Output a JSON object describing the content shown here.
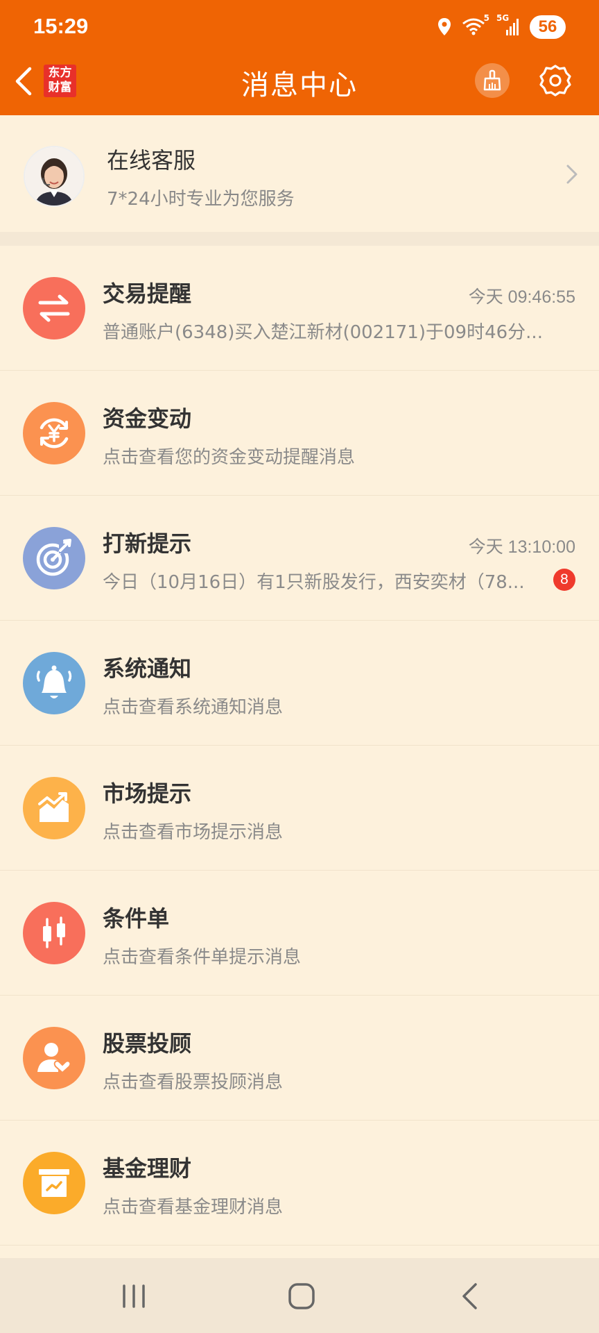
{
  "status_bar": {
    "time": "15:29",
    "wifi_label": "5",
    "network": "5G",
    "battery": "56"
  },
  "header": {
    "logo_text": "东方财富",
    "title": "消息中心"
  },
  "service": {
    "title": "在线客服",
    "subtitle": "7*24小时专业为您服务"
  },
  "messages": [
    {
      "name": "交易提醒",
      "time": "今天 09:46:55",
      "desc": "普通账户(6348)买入楚江新材(002171)于09时46分...",
      "icon": "exchange-icon",
      "color": "#f86f5b"
    },
    {
      "name": "资金变动",
      "time": "",
      "desc": "点击查看您的资金变动提醒消息",
      "icon": "yuan-cycle-icon",
      "color": "#fb9250"
    },
    {
      "name": "打新提示",
      "time": "今天 13:10:00",
      "desc": "今日（10月16日）有1只新股发行，西安奕材（78...",
      "badge": "8",
      "icon": "target-icon",
      "color": "#8aa2d8"
    },
    {
      "name": "系统通知",
      "time": "",
      "desc": "点击查看系统通知消息",
      "icon": "bell-icon",
      "color": "#6fa9d9"
    },
    {
      "name": "市场提示",
      "time": "",
      "desc": "点击查看市场提示消息",
      "icon": "trend-chart-icon",
      "color": "#fdb24a"
    },
    {
      "name": "条件单",
      "time": "",
      "desc": "点击查看条件单提示消息",
      "icon": "candlestick-icon",
      "color": "#f86f5b"
    },
    {
      "name": "股票投顾",
      "time": "",
      "desc": "点击查看股票投顾消息",
      "icon": "advisor-icon",
      "color": "#fb9250"
    },
    {
      "name": "基金理财",
      "time": "",
      "desc": "点击查看基金理财消息",
      "icon": "fund-box-icon",
      "color": "#fbab2a"
    }
  ],
  "colors": {
    "brand": "#ef6404",
    "background": "#fdf1dc",
    "badge": "#ef3a2c"
  }
}
